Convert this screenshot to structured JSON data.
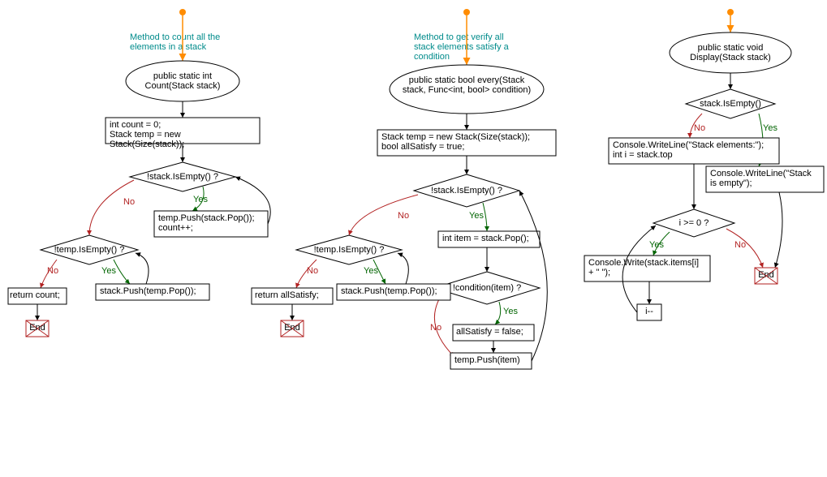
{
  "captions": {
    "c1": "Method to count all the elements in a stack",
    "c2": "Method to get verify all stack elements satisfy a condition",
    "c3": ""
  },
  "flow1": {
    "start": "public static int Count(Stack stack)",
    "b1": "int count = 0;\nStack temp = new Stack(Size(stack));",
    "d1": "!stack.IsEmpty() ?",
    "b2": "temp.Push(stack.Pop());\ncount++;",
    "d2": "!temp.IsEmpty() ?",
    "b3": "stack.Push(temp.Pop());",
    "b4": "return count;",
    "end": "End"
  },
  "flow2": {
    "start": "public static bool every(Stack stack, Func<int, bool> condition)",
    "b1": "Stack temp = new Stack(Size(stack));\nbool allSatisfy = true;",
    "d1": "!stack.IsEmpty() ?",
    "b2": "int item = stack.Pop();",
    "d2": "!condition(item) ?",
    "b3": "allSatisfy = false;",
    "b4": "temp.Push(item)",
    "d3": "!temp.IsEmpty() ?",
    "b5": "stack.Push(temp.Pop());",
    "b6": "return allSatisfy;",
    "end": "End"
  },
  "flow3": {
    "start": "public static void Display(Stack stack)",
    "d1": "stack.IsEmpty()",
    "b1": "Console.WriteLine(\"Stack elements:\");\nint i = stack.top",
    "b2": "Console.WriteLine(\"Stack is empty\");",
    "d2": "i >= 0 ?",
    "b3": "Console.Write(stack.items[i] + \" \");",
    "b4": "i--",
    "end": "End"
  },
  "labels": {
    "yes": "Yes",
    "no": "No"
  }
}
